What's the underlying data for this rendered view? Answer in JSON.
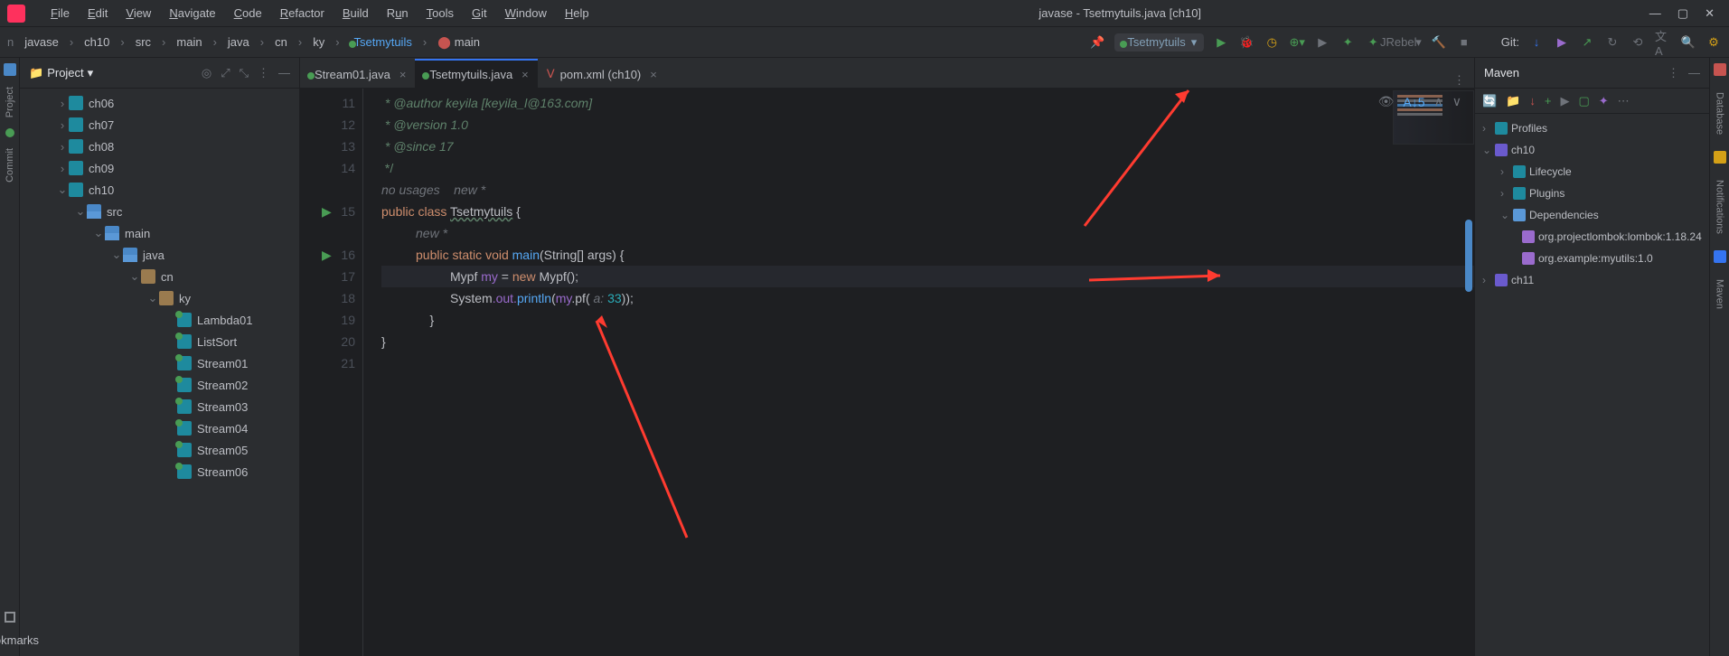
{
  "window": {
    "title": "javase - Tsetmytuils.java [ch10]"
  },
  "menu": {
    "file": "File",
    "edit": "Edit",
    "view": "View",
    "navigate": "Navigate",
    "code": "Code",
    "refactor": "Refactor",
    "build": "Build",
    "run": "Run",
    "tools": "Tools",
    "git": "Git",
    "window": "Window",
    "help": "Help"
  },
  "breadcrumb": {
    "root": "javase",
    "mod": "ch10",
    "src": "src",
    "main": "main",
    "java": "java",
    "cn": "cn",
    "ky": "ky",
    "cls": "Tsetmytuils",
    "mth": "main"
  },
  "runConfig": {
    "name": "Tsetmytuils"
  },
  "toolbar": {
    "git": "Git:",
    "jrebel": "JRebel"
  },
  "project": {
    "label": "Project",
    "tree": {
      "ch06": "ch06",
      "ch07": "ch07",
      "ch08": "ch08",
      "ch09": "ch09",
      "ch10": "ch10",
      "src": "src",
      "main": "main",
      "java": "java",
      "cn": "cn",
      "ky": "ky",
      "Lambda01": "Lambda01",
      "ListSort": "ListSort",
      "Stream01": "Stream01",
      "Stream02": "Stream02",
      "Stream03": "Stream03",
      "Stream04": "Stream04",
      "Stream05": "Stream05",
      "Stream06": "Stream06"
    }
  },
  "tabs": {
    "t1": "Stream01.java",
    "t2": "Tsetmytuils.java",
    "t3": "pom.xml (ch10)"
  },
  "maven": {
    "label": "Maven",
    "profiles": "Profiles",
    "ch10": "ch10",
    "lifecycle": "Lifecycle",
    "plugins": "Plugins",
    "deps": "Dependencies",
    "dep1": "org.projectlombok:lombok:1.18.24",
    "dep2": "org.example:myutils:1.0",
    "ch11": "ch11"
  },
  "editor": {
    "inspect": "5",
    "usages": "no usages    new *",
    "newmark": "new *",
    "lines": {
      "l11": " * @author keyila [keyila_l@163.com]",
      "l12": " * @version 1.0",
      "l13": " * @since 17",
      "l14": " */",
      "l16_kw1": "public",
      "l16_kw2": "class",
      "l16_name": "Tsetmytuils",
      "l16_brace": " {",
      "l18_kw1": "public",
      "l18_kw2": "static",
      "l18_kw3": "void",
      "l18_mth": "main",
      "l18_sig": "(String[] args) {",
      "l19_typ": "Mypf",
      "l19_var": "my",
      "l19_eq": " = ",
      "l19_new": "new",
      "l19_ctor": " Mypf",
      "l19_end": "();",
      "l20_sys": "System",
      "l20_out": ".out.",
      "l20_pr": "println",
      "l20_open": "(",
      "l20_my": "my",
      "l20_pf": ".pf(",
      "l20_hint": " a: ",
      "l20_num": "33",
      "l20_close": "));",
      "l21": "    }",
      "l22": "}"
    },
    "lineNums": {
      "n11": "11",
      "n12": "12",
      "n13": "13",
      "n14": "14",
      "n16": "16",
      "n17": "17",
      "n18": "18",
      "n19": "19",
      "n20": "20",
      "n21": "21"
    }
  },
  "rails": {
    "project": "Project",
    "commit": "Commit",
    "bookmarks": "Bookmarks",
    "database": "Database",
    "maven": "Maven",
    "notifications": "Notifications"
  }
}
